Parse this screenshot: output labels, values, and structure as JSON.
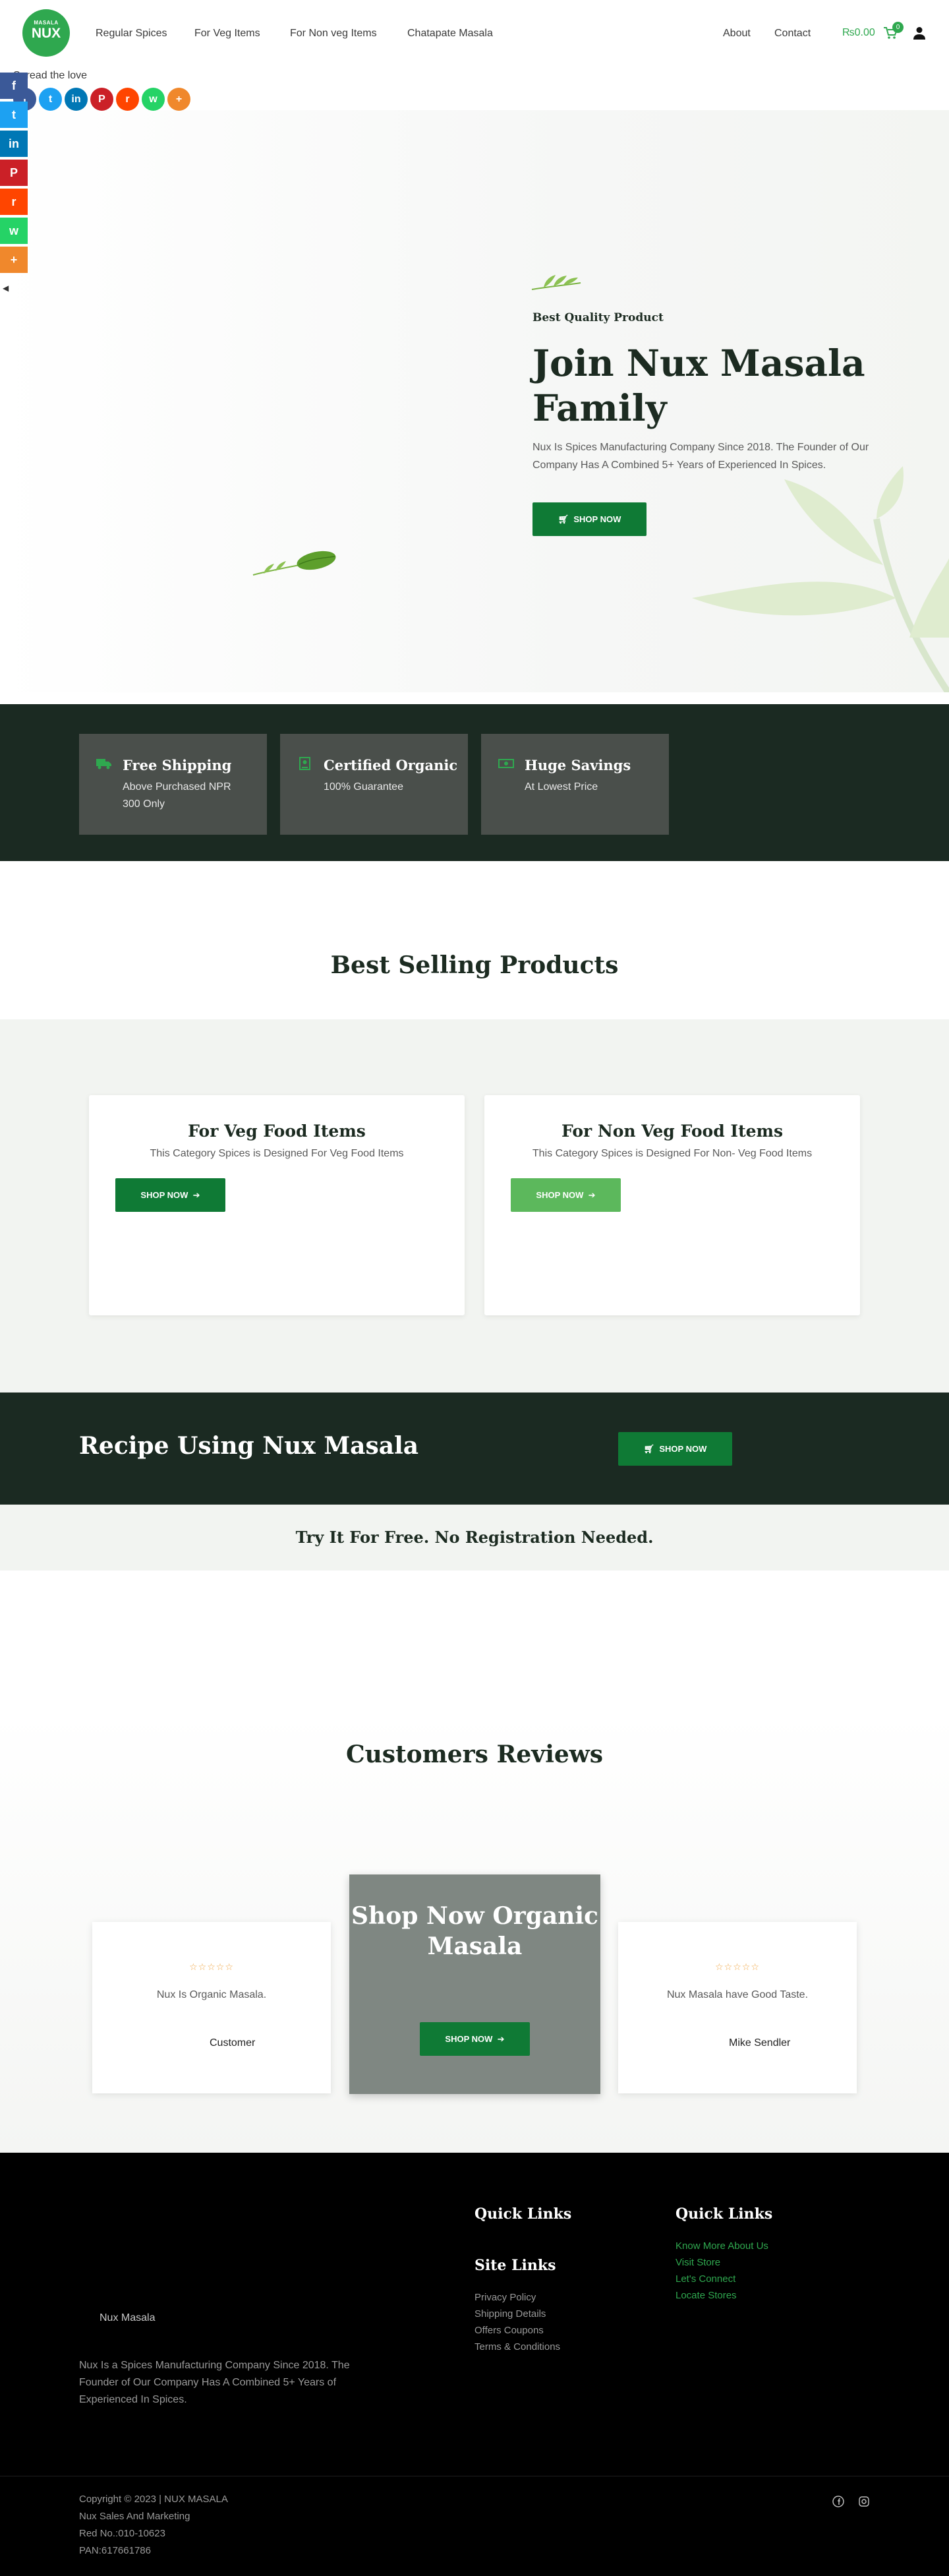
{
  "header": {
    "logo_small": "MASALA",
    "logo_big": "NUX",
    "nav": [
      "Regular Spices",
      "For Veg Items",
      "For Non veg Items",
      "Chatapate Masala"
    ],
    "nav_right": [
      "About",
      "Contact"
    ],
    "cart_amount": "₨0.00",
    "cart_count": "0"
  },
  "share": {
    "spread_label": "Spread the love",
    "icons": [
      "facebook-icon",
      "twitter-icon",
      "linkedin-icon",
      "pinterest-icon",
      "reddit-icon",
      "whatsapp-icon",
      "more-icon"
    ],
    "colors": [
      "#3b5998",
      "#1da1f2",
      "#0077b5",
      "#cb2027",
      "#ff4500",
      "#25d366",
      "#f0882c"
    ]
  },
  "hero": {
    "subtitle": "Best Quality Product",
    "title": "Join Nux Masala Family",
    "description": "Nux Is Spices Manufacturing Company Since 2018. The Founder of Our Company Has A Combined 5+ Years of Experienced In Spices.",
    "button": "SHOP NOW"
  },
  "features": [
    {
      "title": "Free Shipping",
      "desc": "Above Purchased NPR 300 Only",
      "icon": "truck-icon"
    },
    {
      "title": "Certified Organic",
      "desc": "100% Guarantee",
      "icon": "certificate-icon"
    },
    {
      "title": "Huge Savings",
      "desc": "At Lowest Price",
      "icon": "money-icon"
    }
  ],
  "best_selling": {
    "title": "Best Selling Products",
    "cards": [
      {
        "title": "For Veg Food Items",
        "desc": "This Category Spices is Designed For Veg Food Items",
        "button": "SHOP NOW"
      },
      {
        "title": "For Non Veg Food Items",
        "desc": "This Category Spices is Designed For Non- Veg Food Items",
        "button": "SHOP NOW"
      }
    ]
  },
  "recipe": {
    "title": "Recipe Using Nux Masala",
    "button": "SHOP NOW",
    "tagline": "Try It For Free. No Registration Needed."
  },
  "reviews": {
    "title": "Customers Reviews",
    "stars": "☆☆☆☆☆",
    "items": [
      {
        "text": "Nux Is Organic Masala.",
        "author": "Customer"
      },
      {
        "text": "Nux Masala have Good Taste.",
        "author": "Mike Sendler"
      }
    ],
    "promo_title": "Shop Now Organic Masala",
    "promo_button": "SHOP NOW"
  },
  "footer": {
    "brand": "Nux Masala",
    "about": "Nux Is a Spices Manufacturing Company Since 2018. The Founder of Our Company Has A Combined 5+ Years of Experienced In Spices.",
    "quick_links_title": "Quick Links",
    "site_links_title": "Site Links",
    "site_links": [
      "Privacy Policy",
      "Shipping Details",
      "Offers Coupons",
      "Terms & Conditions"
    ],
    "quick_links_2_title": "Quick Links",
    "quick_links_2": [
      "Know More About Us",
      "Visit Store",
      "Let's Connect",
      "Locate Stores"
    ],
    "copyright": "Copyright © 2023 | NUX MASALA",
    "company": "Nux Sales And Marketing",
    "reg": "Red No.:010-10623",
    "pan": "PAN:617661786"
  },
  "colors": {
    "brand_green": "#0f7a35",
    "accent_green": "#2fa84f",
    "dark_bg": "#1b2a22",
    "light_btn": "#5cb85c"
  }
}
